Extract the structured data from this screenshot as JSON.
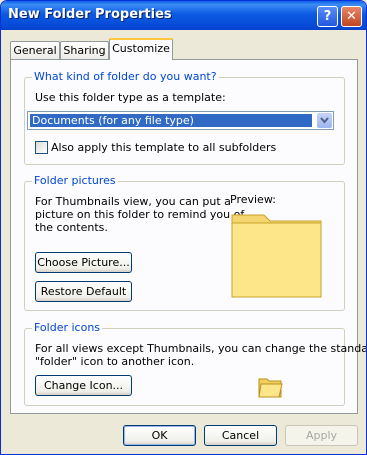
{
  "window": {
    "title": "New Folder Properties",
    "help_label": "?",
    "close_label": "✕"
  },
  "tabs": [
    {
      "label": "General"
    },
    {
      "label": "Sharing"
    },
    {
      "label": "Customize"
    }
  ],
  "folder_type": {
    "group_title": "What kind of folder do you want?",
    "template_label": "Use this folder type as a template:",
    "selected_template": "Documents (for any file type)",
    "apply_subfolders_label": "Also apply this template to all subfolders",
    "apply_subfolders_checked": false
  },
  "folder_pictures": {
    "group_title": "Folder pictures",
    "description_line1": "For Thumbnails view, you can put a",
    "description_line2": "picture on this folder to remind you of",
    "description_line3": "the contents.",
    "preview_label": "Preview:",
    "choose_picture_label": "Choose Picture...",
    "restore_default_label": "Restore Default"
  },
  "folder_icons": {
    "group_title": "Folder icons",
    "description_line1": "For all views except Thumbnails, you can change the standard",
    "description_line2": "\"folder\" icon to another icon.",
    "change_icon_label": "Change Icon..."
  },
  "footer": {
    "ok_label": "OK",
    "cancel_label": "Cancel",
    "apply_label": "Apply"
  }
}
